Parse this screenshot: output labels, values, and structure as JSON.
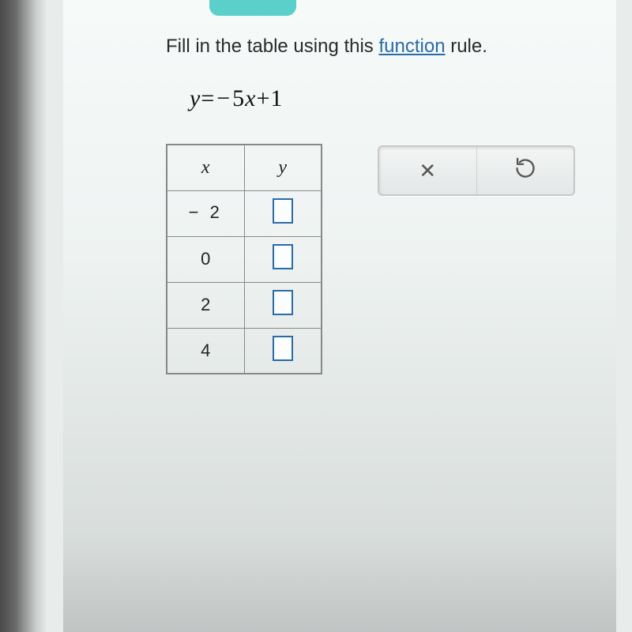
{
  "instruction": {
    "prefix": "Fill in the table using this ",
    "linked_word": "function",
    "suffix": " rule."
  },
  "equation_text": "y = −5x + 1",
  "table": {
    "headers": {
      "x": "x",
      "y": "y"
    },
    "x_values": [
      "− 2",
      "0",
      "2",
      "4"
    ]
  },
  "controls": {
    "clear_symbol": "✕",
    "reset_label": "reset"
  },
  "colors": {
    "link": "#2a6aa8",
    "input_border": "#2a6aa8",
    "teal": "#5bcfc9"
  }
}
